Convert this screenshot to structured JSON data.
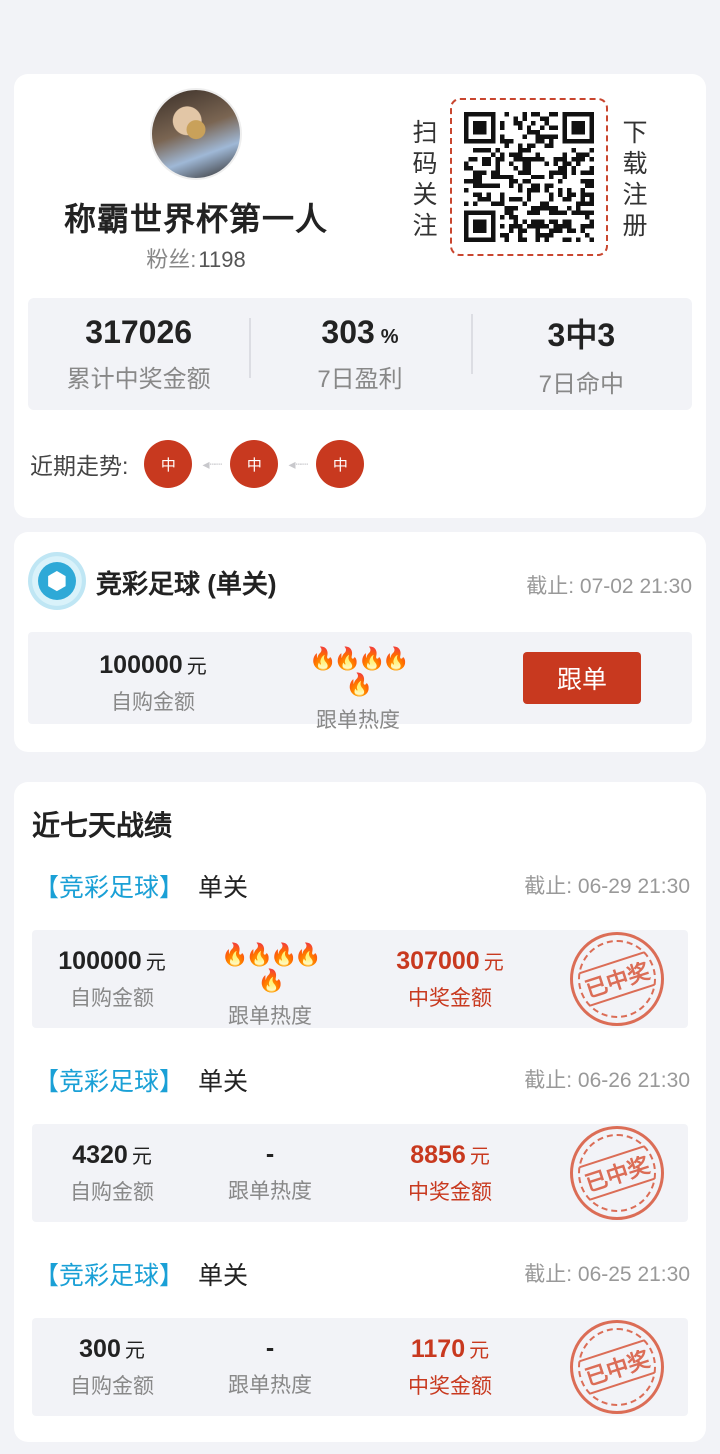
{
  "profile": {
    "nickname": "称霸世界杯第一人",
    "fans_label": "粉丝:",
    "fans_count": "1198",
    "scan_label": [
      "扫",
      "码",
      "关",
      "注"
    ],
    "register_label": [
      "下",
      "载",
      "注",
      "册"
    ]
  },
  "stats": [
    {
      "value": "317026",
      "unit": "",
      "label": "累计中奖金额"
    },
    {
      "value": "303",
      "unit": "%",
      "label": "7日盈利"
    },
    {
      "value": "3中3",
      "unit": "",
      "label": "7日命中"
    }
  ],
  "trend": {
    "label": "近期走势:",
    "items": [
      "中",
      "中",
      "中"
    ]
  },
  "current": {
    "title": "竞彩足球 (单关)",
    "deadline": "截止: 07-02 21:30",
    "amount": "100000",
    "unit": "元",
    "amount_label": "自购金额",
    "heat_label": "跟单热度",
    "heat_level": 5,
    "follow_button": "跟单"
  },
  "record": {
    "title": "近七天战绩",
    "items": [
      {
        "category": "【竞彩足球】",
        "type": "单关",
        "deadline": "截止: 06-29 21:30",
        "amount": "100000",
        "unit": "元",
        "amount_label": "自购金额",
        "heat": "",
        "heat_level": 5,
        "heat_label": "跟单热度",
        "win": "307000",
        "win_unit": "元",
        "win_label": "中奖金额",
        "stamp": "已中奖"
      },
      {
        "category": "【竞彩足球】",
        "type": "单关",
        "deadline": "截止: 06-26 21:30",
        "amount": "4320",
        "unit": "元",
        "amount_label": "自购金额",
        "heat": "-",
        "heat_level": 0,
        "heat_label": "跟单热度",
        "win": "8856",
        "win_unit": "元",
        "win_label": "中奖金额",
        "stamp": "已中奖"
      },
      {
        "category": "【竞彩足球】",
        "type": "单关",
        "deadline": "截止: 06-25 21:30",
        "amount": "300",
        "unit": "元",
        "amount_label": "自购金额",
        "heat": "-",
        "heat_level": 0,
        "heat_label": "跟单热度",
        "win": "1170",
        "win_unit": "元",
        "win_label": "中奖金额",
        "stamp": "已中奖"
      }
    ]
  },
  "colors": {
    "accent_red": "#c8391f",
    "category_blue": "#1aa0d6",
    "background": "#f2f3f7"
  }
}
